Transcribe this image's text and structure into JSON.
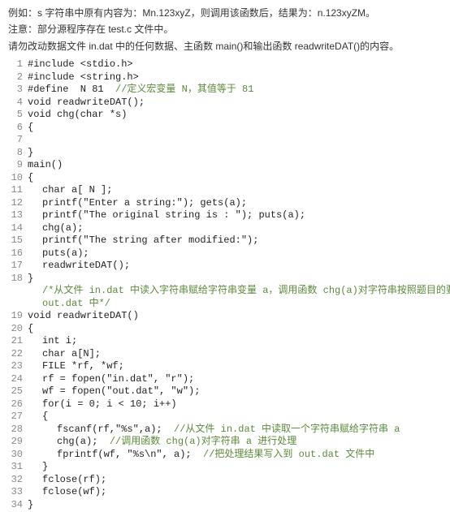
{
  "intro": {
    "line1": "例如：s 字符串中原有内容为：Mn.123xyZ，则调用该函数后，结果为：n.123xyZM。",
    "line2": "注意：部分源程序存在 test.c 文件中。",
    "line3": "请勿改动数据文件 in.dat 中的任何数据、主函数 main()和输出函数 readwriteDAT()的内容。"
  },
  "code": [
    {
      "n": 1,
      "ind": 0,
      "t": "#include <stdio.h>"
    },
    {
      "n": 2,
      "ind": 0,
      "t": "#include <string.h>"
    },
    {
      "n": 3,
      "ind": 0,
      "t": "#define  N 81  ",
      "c": "//定义宏变量 N，其值等于 81"
    },
    {
      "n": 4,
      "ind": 0,
      "t": "void readwriteDAT();"
    },
    {
      "n": 5,
      "ind": 0,
      "t": "void chg(char *s)"
    },
    {
      "n": 6,
      "ind": 0,
      "t": "{"
    },
    {
      "n": 7,
      "ind": 0,
      "t": ""
    },
    {
      "n": 8,
      "ind": 0,
      "t": "}"
    },
    {
      "n": 9,
      "ind": 0,
      "t": "main()"
    },
    {
      "n": 10,
      "ind": 0,
      "t": "{"
    },
    {
      "n": 11,
      "ind": 1,
      "t": "char a[ N ];"
    },
    {
      "n": 12,
      "ind": 1,
      "t": "printf(\"Enter a string:\"); gets(a);"
    },
    {
      "n": 13,
      "ind": 1,
      "t": "printf(\"The original string is : \"); puts(a);"
    },
    {
      "n": 14,
      "ind": 1,
      "t": "chg(a);"
    },
    {
      "n": 15,
      "ind": 1,
      "t": "printf(\"The string after modified:\");"
    },
    {
      "n": 16,
      "ind": 1,
      "t": "puts(a);"
    },
    {
      "n": 17,
      "ind": 1,
      "t": "readwriteDAT();"
    },
    {
      "n": 18,
      "ind": 0,
      "t": "}"
    }
  ],
  "interComment": "/*从文件 in.dat 中读入字符串赋给字符串变量 a，调用函数 chg(a)对字符串按照题目的要求进行处理，并把处理结果写入到文件out.dat 中*/",
  "code2": [
    {
      "n": 19,
      "ind": 0,
      "t": "void readwriteDAT()"
    },
    {
      "n": 20,
      "ind": 0,
      "t": "{"
    },
    {
      "n": 21,
      "ind": 1,
      "t": "int i;"
    },
    {
      "n": 22,
      "ind": 1,
      "t": "char a[N];"
    },
    {
      "n": 23,
      "ind": 1,
      "t": "FILE *rf, *wf;"
    },
    {
      "n": 24,
      "ind": 1,
      "t": "rf = fopen(\"in.dat\", \"r\");"
    },
    {
      "n": 25,
      "ind": 1,
      "t": "wf = fopen(\"out.dat\", \"w\");"
    },
    {
      "n": 26,
      "ind": 1,
      "t": "for(i = 0; i < 10; i++)"
    },
    {
      "n": 27,
      "ind": 1,
      "t": "{"
    },
    {
      "n": 28,
      "ind": 2,
      "t": "fscanf(rf,\"%s\",a);  ",
      "c": "//从文件 in.dat 中读取一个字符串赋给字符串 a"
    },
    {
      "n": 29,
      "ind": 2,
      "t": "chg(a);  ",
      "c": "//调用函数 chg(a)对字符串 a 进行处理"
    },
    {
      "n": 30,
      "ind": 2,
      "t": "fprintf(wf, \"%s\\n\", a);  ",
      "c": "//把处理结果写入到 out.dat 文件中"
    },
    {
      "n": 31,
      "ind": 1,
      "t": "}"
    },
    {
      "n": 32,
      "ind": 1,
      "t": "fclose(rf);"
    },
    {
      "n": 33,
      "ind": 1,
      "t": "fclose(wf);"
    },
    {
      "n": 34,
      "ind": 0,
      "t": "}"
    }
  ]
}
